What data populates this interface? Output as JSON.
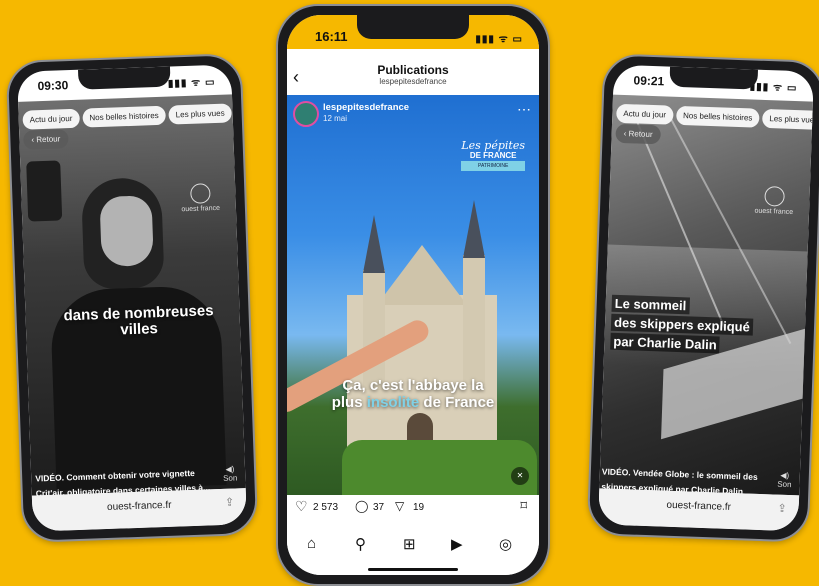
{
  "left_phone": {
    "time": "09:30",
    "status_icons": "▮▮▮ ᯤ ▭",
    "chips": [
      "Actu du jour",
      "Nos belles histoires",
      "Les plus vues"
    ],
    "back_label": "Retour",
    "overlay_text": "dans de nombreuses villes",
    "caption_line1": "VIDÉO. Comment obtenir votre vignette",
    "caption_line2": "Crit'air, obligatoire dans certaines villes à...",
    "sound_label": "Son",
    "url": "ouest-france.fr",
    "logo_text": "ouest france"
  },
  "center_phone": {
    "time": "16:11",
    "status_icons": "▮▮▮ ᯤ ▭",
    "header_title": "Publications",
    "header_subtitle": "lespepitesdefrance",
    "post_account": "lespepitesdefrance",
    "post_date": "12 mai",
    "brand_line1": "Les pépites",
    "brand_line2": "DE FRANCE",
    "brand_line3": "PATRIMOINE",
    "caption_part1": "Ça, c'est l'abbaye la",
    "caption_part2a": "plus ",
    "caption_highlight": "insolite",
    "caption_part2b": " de France",
    "likes": "2 573",
    "comments": "37",
    "shares": "19",
    "highlight_color": "#7fd1e6"
  },
  "right_phone": {
    "time": "09:21",
    "status_icons": "▮▮▮ ᯤ ▭",
    "chips": [
      "Actu du jour",
      "Nos belles histoires",
      "Les plus vues"
    ],
    "back_label": "Retour",
    "headline_lines": [
      "Le sommeil",
      "des skippers expliqué",
      "par Charlie Dalin"
    ],
    "caption_line1": "VIDÉO. Vendée Globe : le sommeil des",
    "caption_line2": "skippers expliqué par Charlie Dalin",
    "sound_label": "Son",
    "url": "ouest-france.fr",
    "logo_text": "ouest france"
  },
  "icons": {
    "heart": "♡",
    "comment": "◯",
    "send": "▽",
    "bookmark": "⌑",
    "home": "⌂",
    "search": "⚲",
    "add": "⊞",
    "reels": "▶",
    "profile": "◎",
    "mute": "🔇",
    "sound": "◀)",
    "share": "⇪",
    "more": "⋯"
  }
}
